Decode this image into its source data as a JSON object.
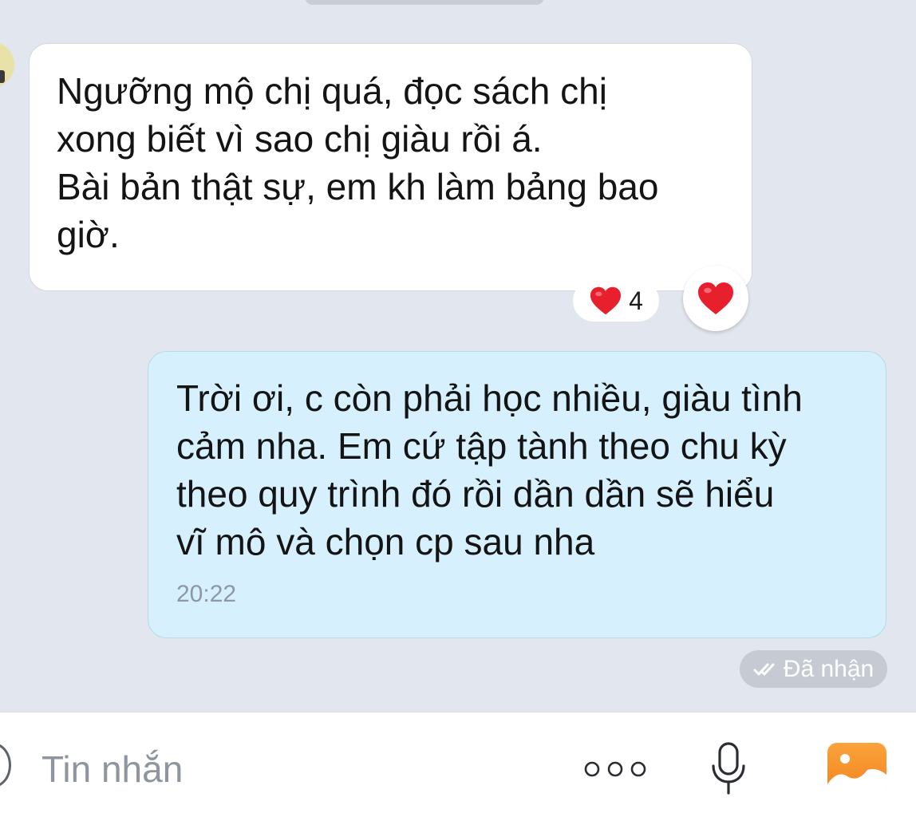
{
  "messages": {
    "incoming": {
      "lines": [
        "Ngưỡng mộ chị quá, đọc sách chị",
        "xong biết vì sao chị giàu rồi á.",
        "Bài bản thật sự, em kh làm bảng bao",
        "giờ."
      ],
      "reaction": {
        "icon": "heart-icon",
        "count": "4"
      }
    },
    "outgoing": {
      "lines": [
        "Trời ơi, c còn phải học nhiều, giàu tình",
        "cảm nha. Em cứ tập tành theo chu kỳ",
        "theo quy trình đó rồi dần dần sẽ hiểu",
        "vĩ mô và chọn cp sau nha"
      ],
      "time": "20:22",
      "status": "Đã nhận"
    }
  },
  "composer": {
    "placeholder": "Tin nhắn",
    "icons": [
      "emoji-icon",
      "more-icon",
      "mic-icon",
      "photo-icon"
    ]
  },
  "colors": {
    "background": "#e2e6ee",
    "incoming_bubble": "#ffffff",
    "outgoing_bubble": "#d6f0fd",
    "heart": "#e8202e",
    "photo_button": "#f7912a"
  }
}
